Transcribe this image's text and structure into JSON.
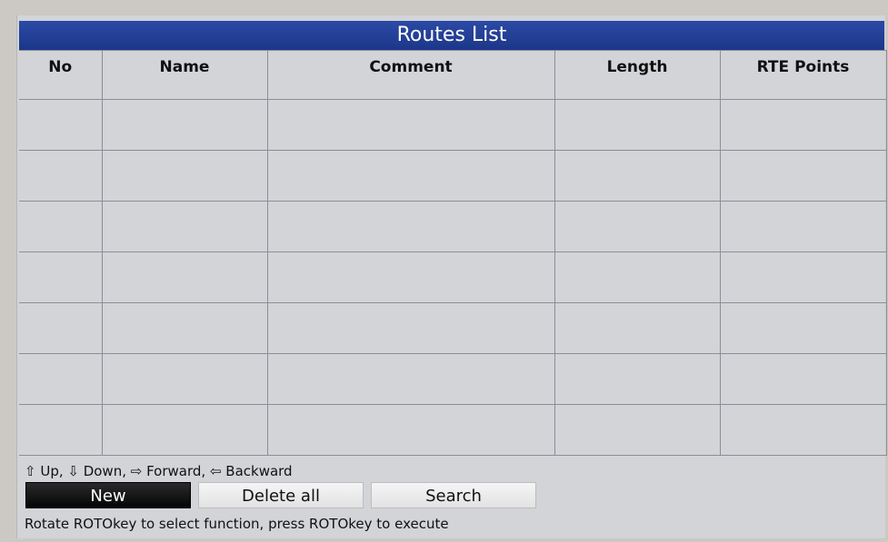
{
  "title": "Routes List",
  "columns": [
    "No",
    "Name",
    "Comment",
    "Length",
    "RTE Points"
  ],
  "hint": "⇧ Up, ⇩ Down, ⇨ Forward, ⇦ Backward",
  "buttons": {
    "new_label": "New",
    "delete_all_label": "Delete all",
    "search_label": "Search"
  },
  "status_text": "Rotate ROTOkey to select function, press ROTOkey to execute"
}
